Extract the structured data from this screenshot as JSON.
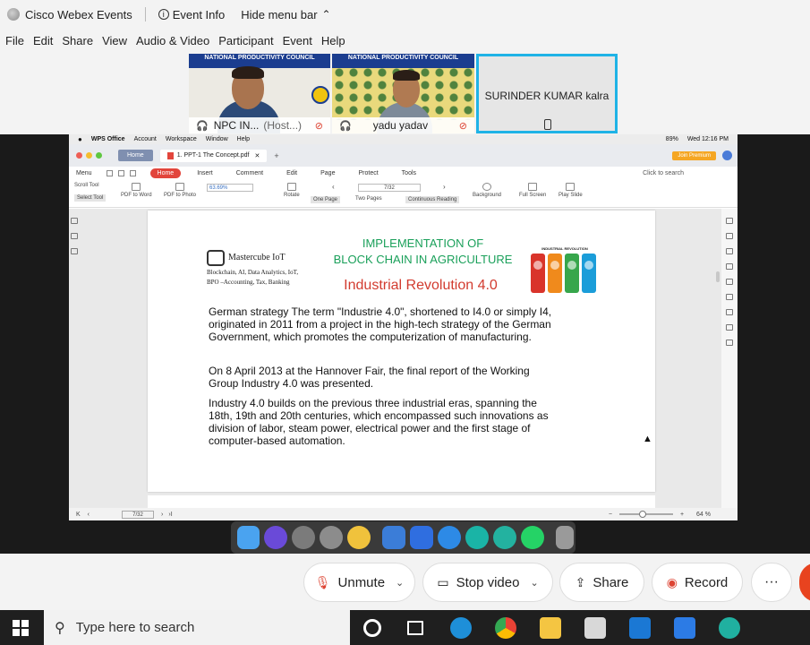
{
  "titlebar": {
    "app_name": "Cisco Webex Events",
    "event_info": "Event Info",
    "hide_menu": "Hide menu bar"
  },
  "menubar": [
    "File",
    "Edit",
    "Share",
    "View",
    "Audio & Video",
    "Participant",
    "Event",
    "Help"
  ],
  "participants": [
    {
      "name": "NPC IN...",
      "role": "(Host...)",
      "banner": "NATIONAL PRODUCTIVITY COUNCIL"
    },
    {
      "name": "yadu yadav",
      "banner": "NATIONAL PRODUCTIVITY COUNCIL"
    },
    {
      "name": "SURINDER KUMAR kalra"
    }
  ],
  "mac_menu": {
    "app": "WPS Office",
    "items": [
      "Account",
      "Workspace",
      "Window",
      "Help"
    ],
    "battery": "89%",
    "clock": "Wed 12:16 PM"
  },
  "wps": {
    "home_tab": "Home",
    "doc_tab": "1. PPT-1 The Concept.pdf",
    "premium": "Join Premium",
    "menu": "Menu",
    "home_btn": "Home",
    "menu_items": [
      "Insert",
      "Comment",
      "Edit",
      "Page",
      "Protect",
      "Tools"
    ],
    "search": "Click to search",
    "tools": {
      "scroll_tool": "Scroll Tool",
      "select_tool": "Select Tool",
      "pdf_to_word": "PDF to Word",
      "pdf_to_photo": "PDF to Photo",
      "zoom": "63.69%",
      "rotate": "Rotate",
      "one_page": "One Page",
      "two_pages": "Two Pages",
      "continuous": "Continuous Reading",
      "page": "7/32",
      "background": "Background",
      "full_screen": "Full Screen",
      "play_slide": "Play Slide"
    },
    "status_page": "7/32",
    "status_zoom": "64 %"
  },
  "slide": {
    "logo_brand": "Mastercube IoT",
    "logo_line1": "Blockchain, AI, Data Analytics, IoT,",
    "logo_line2": "BPO –Accounting, Tax, Banking",
    "title_line1": "IMPLEMENTATION OF",
    "title_line2": "BLOCK CHAIN IN AGRICULTURE",
    "subtitle": "Industrial Revolution 4.0",
    "ir_label": "INDUSTRIAL REVOLUTION",
    "p1": [
      "German strategy The term \"Industrie 4.0\", shortened to I4.0 or simply I4,",
      "originated in 2011 from a project in the high-tech strategy of the German",
      "Government, which promotes the computerization of manufacturing."
    ],
    "p2": [
      "On 8 April 2013 at the Hannover Fair, the final report of the Working",
      "Group Industry 4.0 was presented."
    ],
    "p3": [
      "Industry 4.0 builds on the previous three industrial eras, spanning the",
      "18th, 19th and 20th centuries, which encompassed such innovations as",
      "division of labor, steam power, electrical power and the first stage of",
      "computer-based automation."
    ]
  },
  "controls": {
    "unmute": "Unmute",
    "stop_video": "Stop video",
    "share": "Share",
    "record": "Record",
    "more": "···"
  },
  "taskbar": {
    "search_placeholder": "Type here to search"
  }
}
